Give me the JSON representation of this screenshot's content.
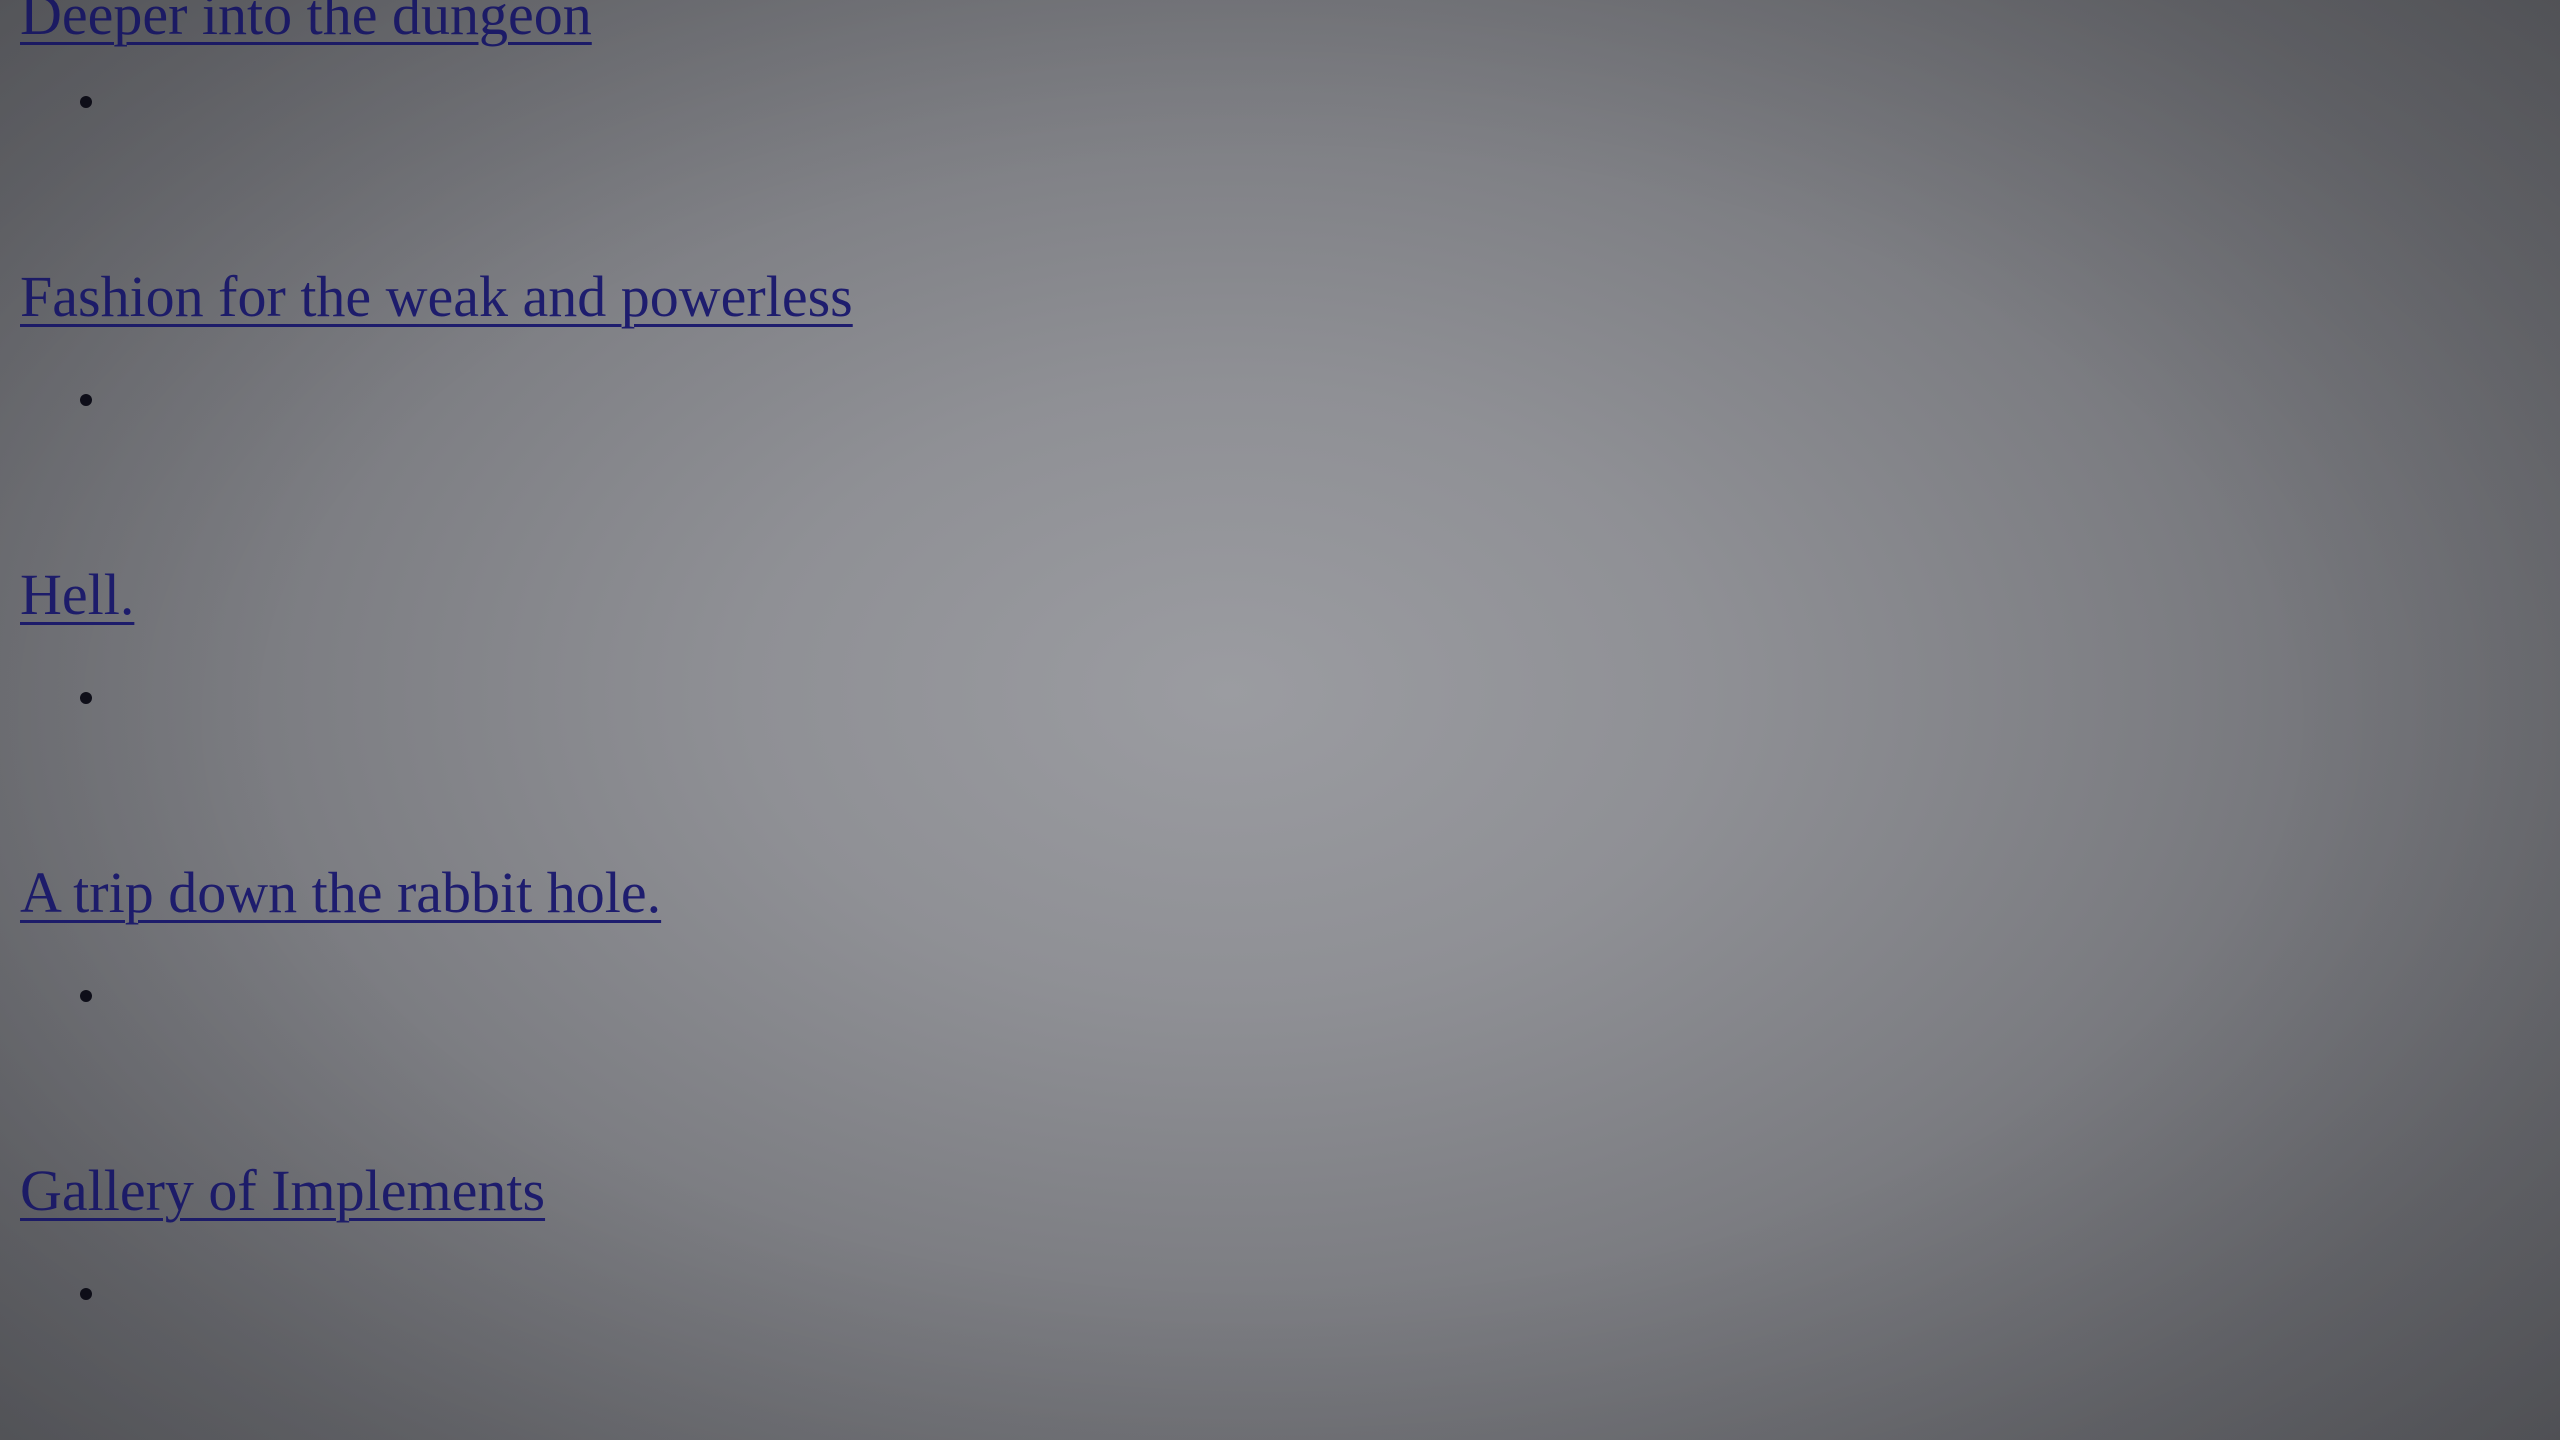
{
  "links": [
    "Deeper into the dungeon",
    "Fashion for the weak and powerless",
    "Hell.",
    "A trip down the rabbit hole.",
    "Gallery of Implements"
  ],
  "colors": {
    "link": "#1e1d6e",
    "bullet": "#0f0f1a",
    "background_center": "#9b9ca1",
    "background_edge": "#55565b"
  }
}
